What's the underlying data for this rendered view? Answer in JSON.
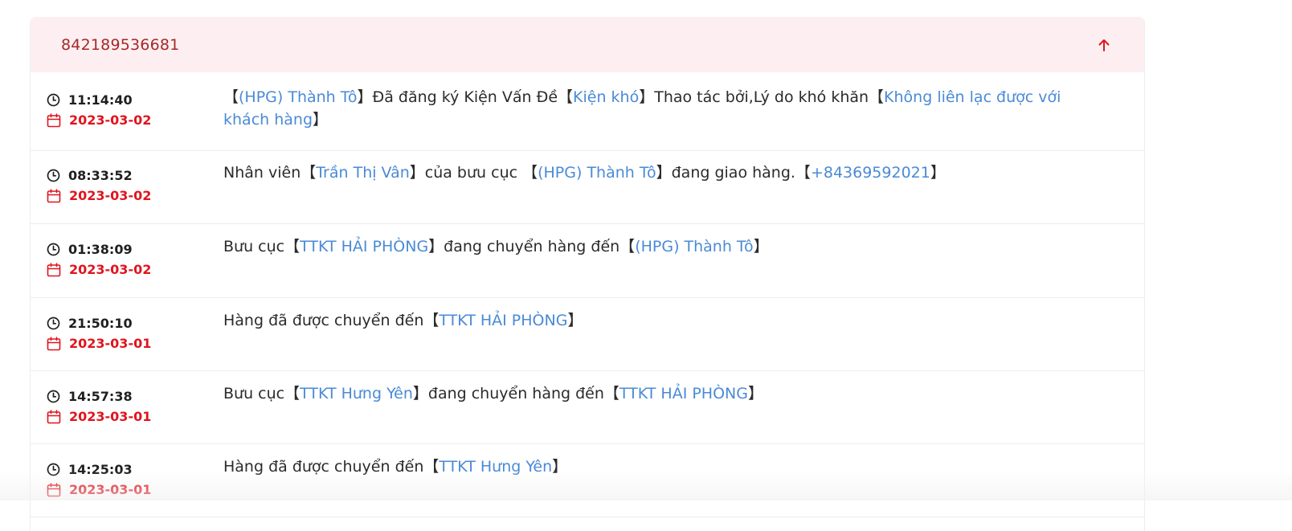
{
  "tracking": {
    "number": "842189536681",
    "collapse_icon": "arrow-up-icon",
    "accent_color": "#e0141e",
    "header_bg": "#fdeff1",
    "link_color": "#4a8ad6"
  },
  "events": [
    {
      "time": "11:14:40",
      "date": "2023-03-02",
      "parts": [
        {
          "t": "【",
          "h": false
        },
        {
          "t": "(HPG) Thành Tô",
          "h": true
        },
        {
          "t": "】Đã đăng ký Kiện Vấn Đề【",
          "h": false
        },
        {
          "t": "Kiện khó",
          "h": true
        },
        {
          "t": "】Thao tác bởi,Lý do khó khăn【",
          "h": false
        },
        {
          "t": "Không liên lạc được với khách hàng",
          "h": true
        },
        {
          "t": "】",
          "h": false
        }
      ]
    },
    {
      "time": "08:33:52",
      "date": "2023-03-02",
      "parts": [
        {
          "t": "Nhân viên【",
          "h": false
        },
        {
          "t": "Trần Thị Vân",
          "h": true
        },
        {
          "t": "】của bưu cục 【",
          "h": false
        },
        {
          "t": "(HPG) Thành Tô",
          "h": true
        },
        {
          "t": "】đang giao hàng.【",
          "h": false
        },
        {
          "t": "+84369592021",
          "h": true
        },
        {
          "t": "】",
          "h": false
        }
      ]
    },
    {
      "time": "01:38:09",
      "date": "2023-03-02",
      "parts": [
        {
          "t": "Bưu cục【",
          "h": false
        },
        {
          "t": "TTKT HẢI PHÒNG",
          "h": true
        },
        {
          "t": "】đang chuyển hàng đến【",
          "h": false
        },
        {
          "t": "(HPG) Thành Tô",
          "h": true
        },
        {
          "t": "】",
          "h": false
        }
      ]
    },
    {
      "time": "21:50:10",
      "date": "2023-03-01",
      "parts": [
        {
          "t": "Hàng đã được chuyển đến【",
          "h": false
        },
        {
          "t": "TTKT HẢI PHÒNG",
          "h": true
        },
        {
          "t": "】",
          "h": false
        }
      ]
    },
    {
      "time": "14:57:38",
      "date": "2023-03-01",
      "parts": [
        {
          "t": "Bưu cục【",
          "h": false
        },
        {
          "t": "TTKT Hưng Yên",
          "h": true
        },
        {
          "t": "】đang chuyển hàng đến【",
          "h": false
        },
        {
          "t": "TTKT HẢI PHÒNG",
          "h": true
        },
        {
          "t": "】",
          "h": false
        }
      ]
    },
    {
      "time": "14:25:03",
      "date": "2023-03-01",
      "parts": [
        {
          "t": "Hàng đã được chuyển đến【",
          "h": false
        },
        {
          "t": "TTKT Hưng Yên",
          "h": true
        },
        {
          "t": "】",
          "h": false
        }
      ]
    }
  ]
}
